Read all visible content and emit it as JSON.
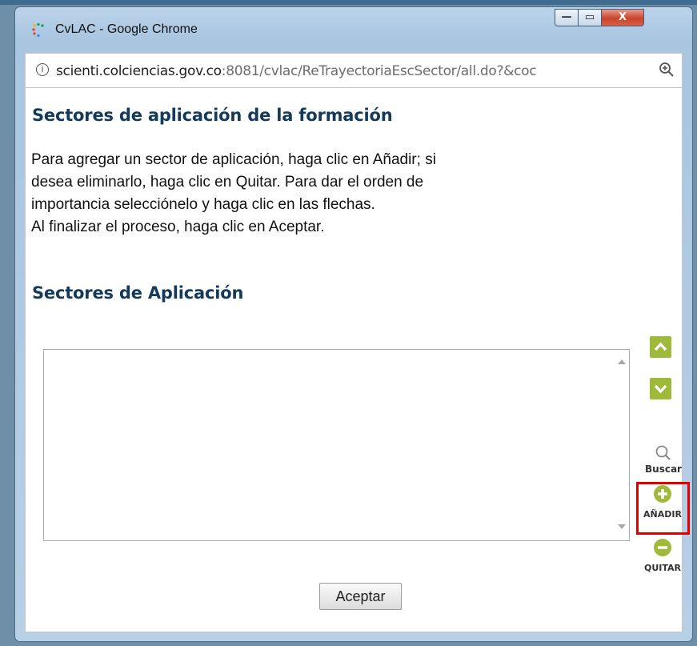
{
  "window": {
    "title": "CvLAC - Google Chrome",
    "controls": {
      "minimize": "—",
      "maximize": "▭",
      "close": "X"
    }
  },
  "address_bar": {
    "host": "scienti.colciencias.gov.co",
    "rest": ":8081/cvlac/ReTrayectoriaEscSector/all.do?&coc"
  },
  "page": {
    "heading": "Sectores de aplicación de la formación",
    "instructions": [
      "Para agregar un sector de aplicación, haga clic en Añadir; si",
      "desea eliminarlo, haga clic en Quitar. Para dar el orden de",
      "importancia selecciónelo y haga clic en las flechas.",
      "Al finalizar el proceso, haga clic en Aceptar."
    ],
    "subheading": "Sectores de Aplicación",
    "tools": {
      "search_label": "Buscar",
      "add_label": "AÑADIR",
      "remove_label": "QUITAR"
    },
    "accept_label": "Aceptar"
  },
  "colors": {
    "heading": "#123a5c",
    "accent_green": "#9fba3b",
    "highlight_red": "#e00000"
  }
}
